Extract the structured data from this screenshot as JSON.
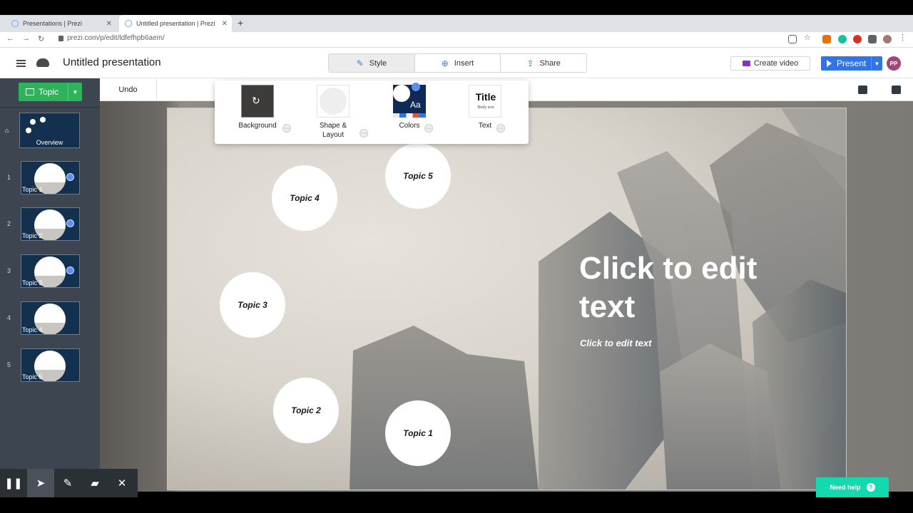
{
  "browser": {
    "tabs": [
      {
        "label": "Presentations | Prezi",
        "close": "✕"
      },
      {
        "label": "Untitled presentation | Prezi",
        "close": "✕"
      }
    ],
    "new_tab": "+",
    "url": "prezi.com/p/edit/ldfefhpb6aem/",
    "nav": {
      "back": "←",
      "forward": "→",
      "reload": "↻"
    }
  },
  "header": {
    "title": "Untitled presentation",
    "tabs": [
      {
        "label": "Style",
        "icon": "pencil-icon"
      },
      {
        "label": "Insert",
        "icon": "plus-circle-icon"
      },
      {
        "label": "Share",
        "icon": "upload-icon"
      }
    ],
    "create_video": "Create video",
    "present": "Present",
    "avatar": "PP"
  },
  "sidebar": {
    "topic_button": "Topic",
    "overview_label": "Overview",
    "slides": [
      {
        "num": "1",
        "label": "Topic 1"
      },
      {
        "num": "2",
        "label": "Topic 2"
      },
      {
        "num": "3",
        "label": "Topic 3"
      },
      {
        "num": "4",
        "label": "Topic 4"
      },
      {
        "num": "5",
        "label": "Topic 5"
      }
    ]
  },
  "toolbar": {
    "undo": "Undo"
  },
  "style_panel": {
    "options": [
      {
        "label": "Background"
      },
      {
        "label": "Shape & Layout"
      },
      {
        "label": "Colors",
        "preview_text": "Aa"
      },
      {
        "label": "Text",
        "preview_title": "Title",
        "preview_body": "Body text"
      }
    ],
    "more": "···"
  },
  "canvas": {
    "topics": [
      "Topic 1",
      "Topic 2",
      "Topic 3",
      "Topic 4",
      "Topic 5"
    ],
    "title": "Click to edit text",
    "subtitle": "Click to edit text"
  },
  "bottom_tools": [
    "pause-icon",
    "pointer-icon",
    "pen-icon",
    "highlighter-icon",
    "close-icon"
  ],
  "help": {
    "label": "Need help",
    "icon": "?"
  },
  "colors": {
    "accent": "#2f74e8",
    "topic_green": "#2fb35a",
    "help": "#13d9b0",
    "sidebar": "#3d4650"
  }
}
